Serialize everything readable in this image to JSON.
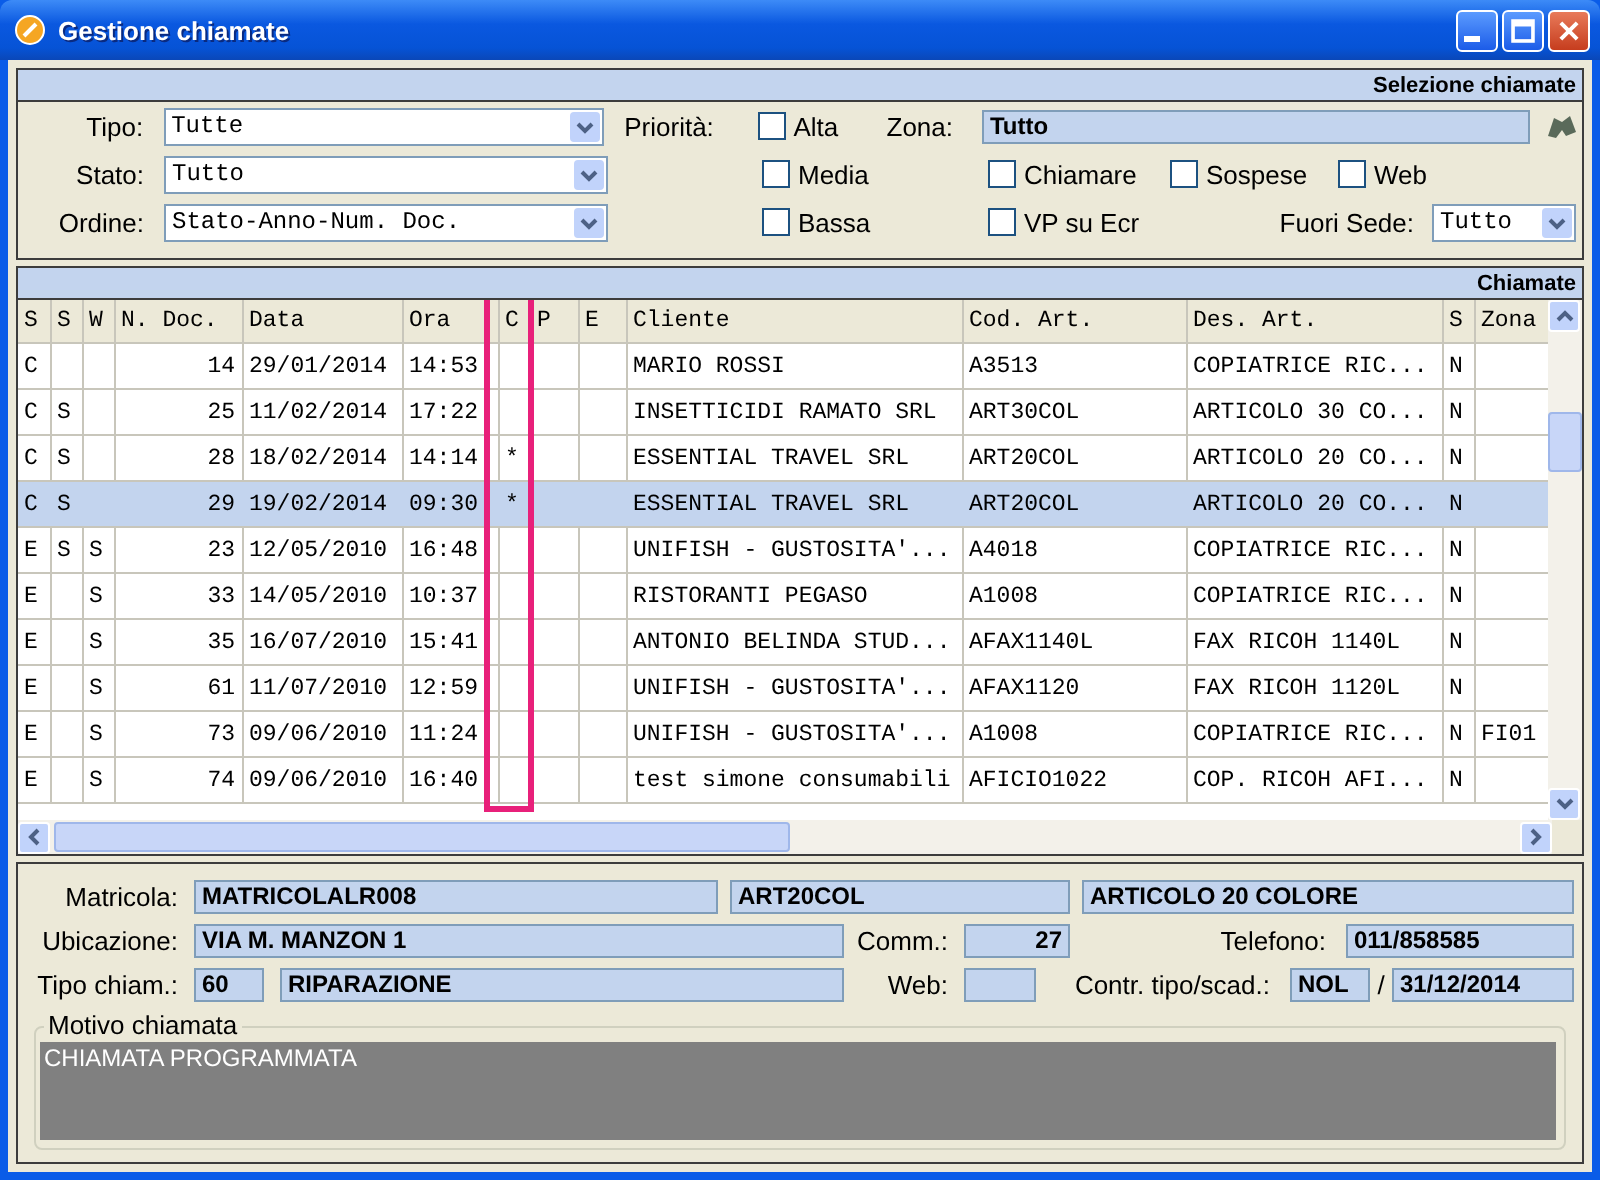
{
  "window": {
    "title": "Gestione chiamate"
  },
  "filters": {
    "header": "Selezione chiamate",
    "tipo": {
      "label": "Tipo:",
      "value": "Tutte"
    },
    "stato": {
      "label": "Stato:",
      "value": "Tutto"
    },
    "ordine": {
      "label": "Ordine:",
      "value": "Stato-Anno-Num. Doc."
    },
    "priorita": {
      "label": "Priorità:",
      "options": [
        {
          "label": "Alta",
          "checked": false
        },
        {
          "label": "Media",
          "checked": false
        },
        {
          "label": "Bassa",
          "checked": false
        }
      ]
    },
    "zona": {
      "label": "Zona:",
      "value": "Tutto"
    },
    "flags": [
      {
        "label": "Chiamare",
        "checked": false
      },
      {
        "label": "Sospese",
        "checked": false
      },
      {
        "label": "Web",
        "checked": false
      },
      {
        "label": "VP su Ecr",
        "checked": false
      }
    ],
    "fuori_sede": {
      "label": "Fuori Sede:",
      "value": "Tutto"
    }
  },
  "table": {
    "header": "Chiamate",
    "columns": [
      "S",
      "S",
      "W",
      "N. Doc.",
      "Data",
      "Ora",
      "C",
      "P",
      "E",
      "Cliente",
      "Cod. Art.",
      "Des. Art.",
      "S",
      "Zona"
    ],
    "rows": [
      {
        "selected": false,
        "cells": [
          "C",
          "",
          "",
          "14",
          "29/01/2014",
          "14:53",
          "",
          "",
          "",
          "MARIO ROSSI",
          "A3513",
          "COPIATRICE RIC...",
          "N",
          ""
        ]
      },
      {
        "selected": false,
        "cells": [
          "C",
          "S",
          "",
          "25",
          "11/02/2014",
          "17:22",
          "",
          "",
          "",
          "INSETTICIDI RAMATO SRL",
          "ART30COL",
          "ARTICOLO 30 CO...",
          "N",
          ""
        ]
      },
      {
        "selected": false,
        "cells": [
          "C",
          "S",
          "",
          "28",
          "18/02/2014",
          "14:14",
          "*",
          "",
          "",
          "ESSENTIAL TRAVEL SRL",
          "ART20COL",
          "ARTICOLO 20 CO...",
          "N",
          ""
        ]
      },
      {
        "selected": true,
        "cells": [
          "C",
          "S",
          "",
          "29",
          "19/02/2014",
          "09:30",
          "*",
          "",
          "",
          "ESSENTIAL TRAVEL SRL",
          "ART20COL",
          "ARTICOLO 20 CO...",
          "N",
          ""
        ]
      },
      {
        "selected": false,
        "cells": [
          "E",
          "S",
          "S",
          "23",
          "12/05/2010",
          "16:48",
          "",
          "",
          "",
          "UNIFISH - GUSTOSITA'...",
          "A4018",
          "COPIATRICE RIC...",
          "N",
          ""
        ]
      },
      {
        "selected": false,
        "cells": [
          "E",
          "",
          "S",
          "33",
          "14/05/2010",
          "10:37",
          "",
          "",
          "",
          "RISTORANTI PEGASO",
          "A1008",
          "COPIATRICE RIC...",
          "N",
          ""
        ]
      },
      {
        "selected": false,
        "cells": [
          "E",
          "",
          "S",
          "35",
          "16/07/2010",
          "15:41",
          "",
          "",
          "",
          "ANTONIO BELINDA STUD...",
          "AFAX1140L",
          "FAX RICOH 1140L",
          "N",
          ""
        ]
      },
      {
        "selected": false,
        "cells": [
          "E",
          "",
          "S",
          "61",
          "11/07/2010",
          "12:59",
          "",
          "",
          "",
          "UNIFISH - GUSTOSITA'...",
          "AFAX1120",
          "FAX RICOH 1120L",
          "N",
          ""
        ]
      },
      {
        "selected": false,
        "cells": [
          "E",
          "",
          "S",
          "73",
          "09/06/2010",
          "11:24",
          "",
          "",
          "",
          "UNIFISH - GUSTOSITA'...",
          "A1008",
          "COPIATRICE RIC...",
          "N",
          "FI01"
        ]
      },
      {
        "selected": false,
        "cells": [
          "E",
          "",
          "S",
          "74",
          "09/06/2010",
          "16:40",
          "",
          "",
          "",
          "test simone consumabili",
          "AFICIO1022",
          "COP. RICOH AFI...",
          "N",
          ""
        ]
      }
    ]
  },
  "details": {
    "matricola": {
      "label": "Matricola:",
      "value": "MATRICOLALR008",
      "articolo": "ART20COL",
      "descrizione": "ARTICOLO 20 COLORE"
    },
    "ubicazione": {
      "label": "Ubicazione:",
      "value": "VIA M. MANZON 1"
    },
    "comm": {
      "label": "Comm.:",
      "value": "27"
    },
    "telefono": {
      "label": "Telefono:",
      "value": "011/858585"
    },
    "tipo_chiam": {
      "label": "Tipo chiam.:",
      "code": "60",
      "value": "RIPARAZIONE"
    },
    "web": {
      "label": "Web:"
    },
    "contratto": {
      "label": "Contr. tipo/scad.:",
      "tipo": "NOL",
      "separator": "/",
      "scadenza": "31/12/2014"
    },
    "motivo": {
      "label": "Motivo chiamata",
      "value": "CHIAMATA PROGRAMMATA"
    }
  }
}
